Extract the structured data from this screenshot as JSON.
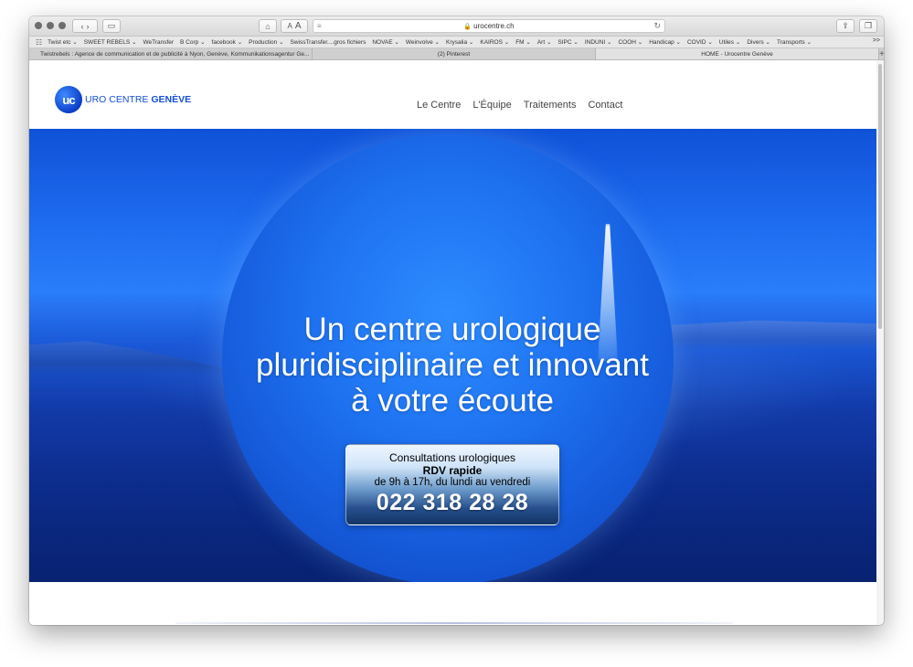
{
  "browser": {
    "url": "urocentre.ch",
    "bookmarks": [
      "Twist etc ⌄",
      "SWEET REBELS ⌄",
      "WeTransfer",
      "B Corp ⌄",
      "facebook ⌄",
      "Production ⌄",
      "SwissTransfer....gros fichiers",
      "NOVAE ⌄",
      "Weinvolve ⌄",
      "Krysalia ⌄",
      "KAIROS ⌄",
      "FM ⌄",
      "Art ⌄",
      "SIPC ⌄",
      "INDUNI ⌄",
      "COOH ⌄",
      "Handicap ⌄",
      "COVID ⌄",
      "Utiles ⌄",
      "Divers ⌄",
      "Transports ⌄"
    ],
    "bookmarks_more": ">>",
    "tabs": [
      "Twistrebels : Agence de communication et de publicité à Nyon, Genève, Kommunikationsagentur Ge...",
      "(2) Pinterest",
      "HOME - Urocentre Genève"
    ],
    "active_tab": 2
  },
  "site": {
    "logo_mark": "uc",
    "logo_text_a": "URO CENTRE",
    "logo_text_b": "GENÈVE",
    "nav": [
      "Le Centre",
      "L'Équipe",
      "Traitements",
      "Contact"
    ]
  },
  "hero": {
    "headline": [
      "Un centre urologique",
      "pluridisciplinaire et innovant",
      "à votre écoute"
    ],
    "cta_line1": "Consultations urologiques",
    "cta_line2": "RDV rapide",
    "cta_line3": "de 9h à 17h, du lundi au vendredi",
    "phone": "022 318 28 28"
  },
  "colors": {
    "brand_blue": "#1450d4",
    "hero_blue": "#1f6df0"
  }
}
